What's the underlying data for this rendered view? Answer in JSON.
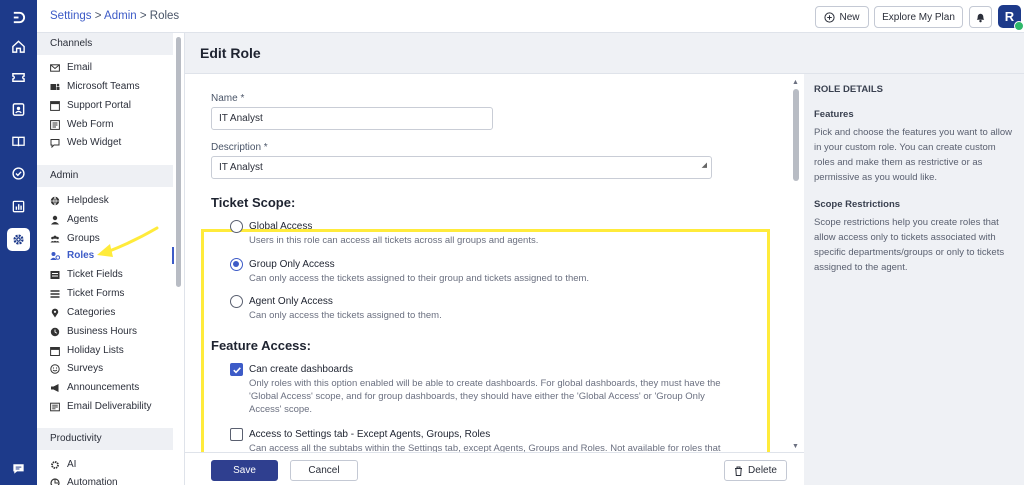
{
  "rail": {
    "icons": [
      "logo-icon",
      "home-icon",
      "ticket-icon",
      "contacts-icon",
      "knowledge-base-icon",
      "tasks-icon",
      "reports-icon",
      "settings-icon",
      "chat-icon"
    ]
  },
  "header": {
    "breadcrumb": {
      "settings": "Settings",
      "sep1": " > ",
      "admin": "Admin",
      "sep2": " > ",
      "current": "Roles"
    },
    "new_label": "New",
    "explore_label": "Explore My Plan",
    "avatar_initial": "R"
  },
  "sidebar": {
    "channels_heading": "Channels",
    "channels": [
      "Email",
      "Microsoft Teams",
      "Support Portal",
      "Web Form",
      "Web Widget"
    ],
    "admin_heading": "Admin",
    "admin": [
      "Helpdesk",
      "Agents",
      "Groups",
      "Roles",
      "Ticket Fields",
      "Ticket Forms",
      "Categories",
      "Business Hours",
      "Holiday Lists",
      "Surveys",
      "Announcements",
      "Email Deliverability"
    ],
    "active_item": "Roles",
    "productivity_heading": "Productivity",
    "productivity": [
      "AI",
      "Automation"
    ]
  },
  "page": {
    "title": "Edit Role"
  },
  "form": {
    "name_label": "Name *",
    "name_value": "IT Analyst",
    "description_label": "Description *",
    "description_value": "IT Analyst",
    "ticket_scope_title": "Ticket Scope:",
    "scope_options": [
      {
        "title": "Global Access",
        "desc": "Users in this role can access all tickets across all groups and agents.",
        "selected": false
      },
      {
        "title": "Group Only Access",
        "desc": "Can only access the tickets assigned to their group and tickets assigned to them.",
        "selected": true
      },
      {
        "title": "Agent Only Access",
        "desc": "Can only access the tickets assigned to them.",
        "selected": false
      }
    ],
    "feature_access_title": "Feature Access:",
    "features": [
      {
        "title": "Can create dashboards",
        "desc_lines": [
          "Only roles with this option enabled will be able to create dashboards. For global dashboards, they must have the",
          "'Global Access' scope, and for group dashboards, they should have either the 'Global Access' or 'Group Only",
          "Access' scope."
        ],
        "checked": true
      },
      {
        "title": "Access to Settings tab - Except Agents, Groups, Roles",
        "desc_lines": [
          "Can access all the subtabs within the Settings tab, except Agents, Groups and Roles. Not available for roles that"
        ],
        "checked": false
      }
    ]
  },
  "footer": {
    "save_label": "Save",
    "cancel_label": "Cancel",
    "delete_label": "Delete"
  },
  "details": {
    "heading": "ROLE DETAILS",
    "features_heading": "Features",
    "features_text": "Pick and choose the features you want to allow in your custom role. You can create custom roles and make them as restrictive or as permissive as you would like.",
    "scope_heading": "Scope Restrictions",
    "scope_text": "Scope restrictions help you create roles that allow access only to tickets associated with specific departments/groups or only to tickets assigned to the agent."
  },
  "colors": {
    "rail": "#1d3a8a",
    "accent": "#3d5bc7",
    "highlight": "#ffeb3b",
    "save": "#2f3f8f"
  }
}
